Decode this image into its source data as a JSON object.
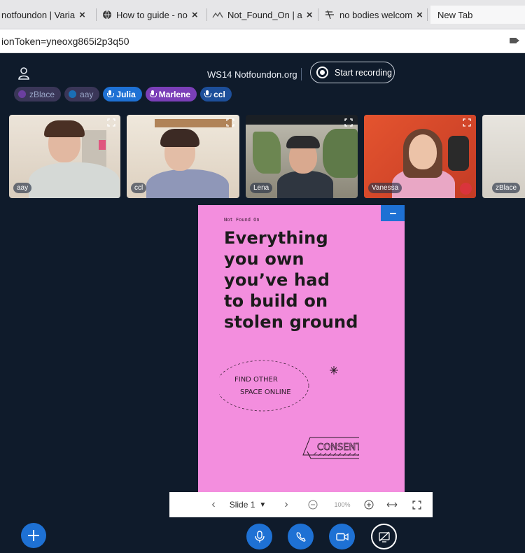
{
  "browser": {
    "tabs": [
      {
        "label": "notfoundon | Varia",
        "icon": "site-icon"
      },
      {
        "label": "How to guide - no",
        "icon": "globe-icon"
      },
      {
        "label": "Not_Found_On | a",
        "icon": "bbb-icon"
      },
      {
        "label": "no bodies welcom",
        "icon": "strike-icon"
      },
      {
        "label": "New Tab",
        "icon": ""
      }
    ],
    "url": "ionToken=yneoxg865i2p3q50"
  },
  "meeting": {
    "title": "WS14 Notfoundon.org",
    "record_label": "Start recording"
  },
  "users": [
    {
      "name": "zBlace",
      "state": "muted",
      "color": "#6b3fa0"
    },
    {
      "name": "aay",
      "state": "muted",
      "color": "#1a6fb5"
    },
    {
      "name": "Julia",
      "state": "talking",
      "color": "#1e71d4"
    },
    {
      "name": "Marlene",
      "state": "talking",
      "color": "#7b3fb8"
    },
    {
      "name": "ccl",
      "state": "talking",
      "color": "#1d4f9a"
    }
  ],
  "videos": [
    {
      "name": "aay",
      "muted": false
    },
    {
      "name": "ccl",
      "muted": false
    },
    {
      "name": "Lena",
      "muted": false
    },
    {
      "name": "Vanessa",
      "muted": true
    },
    {
      "name": "zBlace",
      "muted": false
    }
  ],
  "slide": {
    "small_text": "Not Found On",
    "headline_lines": [
      "Everything",
      "you own",
      "you’ve had",
      "to build on",
      "stolen ground"
    ],
    "doodle_text_1": "FIND OTHER",
    "doodle_text_2": "SPACE ONLINE",
    "doodle_text_3": "CONSENT"
  },
  "slidebar": {
    "slide_label": "Slide 1",
    "zoom": "100%"
  },
  "colors": {
    "app_bg": "#0f1b2b",
    "accent": "#1e71d4",
    "slide_bg": "#f38ede"
  }
}
